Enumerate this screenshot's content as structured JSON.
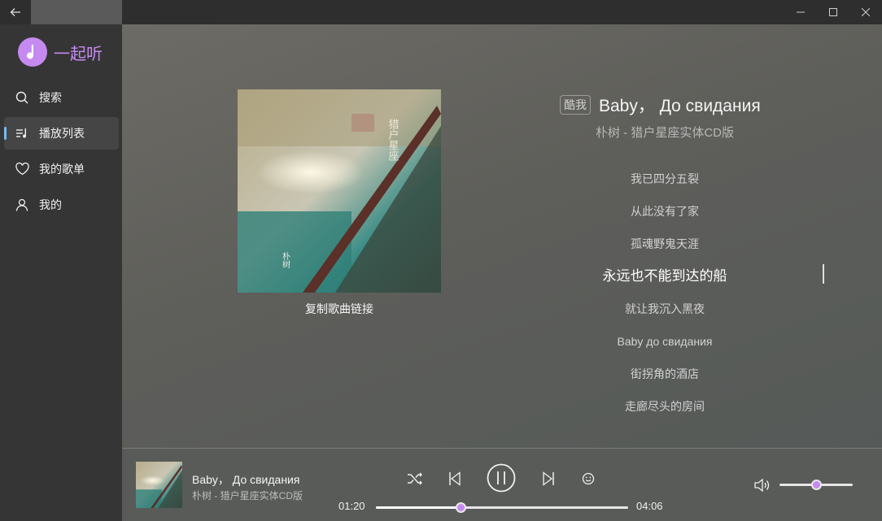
{
  "app": {
    "name": "一起听",
    "accent": "#c58af0"
  },
  "sidebar": {
    "items": [
      {
        "label": "搜索",
        "icon": "search-icon"
      },
      {
        "label": "播放列表",
        "icon": "playlist-icon",
        "active": true
      },
      {
        "label": "我的歌单",
        "icon": "heart-icon"
      },
      {
        "label": "我的",
        "icon": "user-icon"
      }
    ]
  },
  "now_playing": {
    "source": "酷我",
    "title": "Baby，  До свидания",
    "subtitle": "朴树 - 猎户星座实体CD版",
    "cover_text_album": "猎户星座",
    "cover_text_artist": "朴树",
    "copy_link_label": "复制歌曲链接",
    "lyrics": [
      "我已四分五裂",
      "从此没有了家",
      "孤魂野鬼天涯",
      "永远也不能到达的船",
      "就让我沉入黑夜",
      "Baby до свидания",
      "街拐角的酒店",
      "走廊尽头的房间"
    ],
    "current_lyric_index": 3
  },
  "player": {
    "title": "Baby，  До свидания",
    "artist": "朴树 - 猎户星座实体CD版",
    "current_time": "01:20",
    "total_time": "04:06",
    "progress_fraction": 0.337,
    "volume_fraction": 0.5
  }
}
